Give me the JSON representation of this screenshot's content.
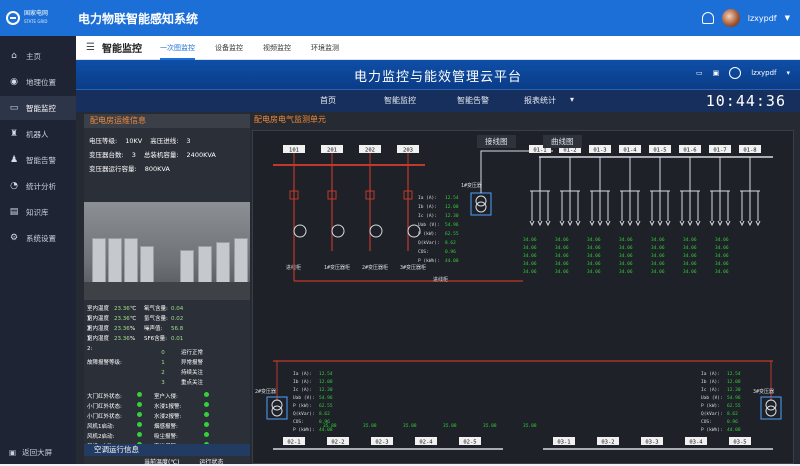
{
  "app": {
    "logo_line1": "国家电网",
    "logo_line2": "STATE GRID",
    "title": "电力物联智能感知系统",
    "user": "lzxypdf"
  },
  "sidebar": {
    "items": [
      {
        "label": "主页",
        "icon": "home-icon"
      },
      {
        "label": "地理位置",
        "icon": "map-pin-icon"
      },
      {
        "label": "智能监控",
        "icon": "monitor-icon"
      },
      {
        "label": "机器人",
        "icon": "robot-icon"
      },
      {
        "label": "智能告警",
        "icon": "alarm-icon"
      },
      {
        "label": "统计分析",
        "icon": "chart-icon"
      },
      {
        "label": "知识库",
        "icon": "book-icon"
      },
      {
        "label": "系统设置",
        "icon": "gear-icon"
      }
    ],
    "bottom": "返回大屏"
  },
  "subnav": {
    "page_title": "智能监控",
    "tabs": [
      "一次图监控",
      "设备监控",
      "视频监控",
      "环境监测"
    ]
  },
  "platform": {
    "title": "电力监控与能效管理云平台",
    "user": "lzxypdf",
    "nav": [
      "首页",
      "智能监控",
      "智能告警",
      "报表统计"
    ],
    "time": "10:44:36"
  },
  "ops": {
    "title": "配电房运维信息",
    "voltage_label": "电压等级:",
    "voltage": "10KV",
    "hv_label": "高压进线:",
    "hv": "3",
    "tx_label": "变压器台数:",
    "tx": "3",
    "cap_label": "总装机容量:",
    "cap": "2400KVA",
    "run_label": "变压器运行容量:",
    "run": "800KVA"
  },
  "monitor": {
    "title": "配电房电气监测单元",
    "tab1": "接线图",
    "tab2": "曲线图"
  },
  "env": {
    "rows": [
      [
        "室内温度1:",
        "23.36",
        "℃",
        "氧气含量:",
        "0.04"
      ],
      [
        "室内温度2:",
        "23.36",
        "℃",
        "氢气含量:",
        "0.02"
      ],
      [
        "室内湿度1:",
        "23.36",
        "%",
        "噪声值:",
        "56.8"
      ],
      [
        "室内湿度2:",
        "23.36",
        "%",
        "SF6含量:",
        "0.01"
      ]
    ],
    "alarm_label": "故障报警等级:",
    "alarm_levels": [
      [
        "0",
        "运行正常"
      ],
      [
        "1",
        "异常报警"
      ],
      [
        "2",
        "持续关注"
      ],
      [
        "3",
        "重点关注"
      ]
    ],
    "doors": [
      [
        "大门红外状态:",
        "室户入侵:"
      ],
      [
        "小门红外状态:",
        "水浸1报警:"
      ],
      [
        "小门红外状态:",
        "水浸2报警:"
      ],
      [
        "风机1启动:",
        "烟感报警:"
      ],
      [
        "风机2启动:",
        "吸尘报警:"
      ],
      [
        "风机3启动:",
        "声光报警:"
      ]
    ]
  },
  "ac": {
    "title": "空调运行信息",
    "col1": "当前温度(℃)",
    "col2": "运行状态"
  },
  "diagram": {
    "hv_bays": [
      "101",
      "201",
      "202",
      "203"
    ],
    "hv_labels": [
      "进线柜",
      "1#变压器柜",
      "2#变压器柜",
      "3#变压器柜"
    ],
    "t1": "1#变压器",
    "t2": "2#变压器",
    "t3": "3#变压器",
    "line_label": "进线柜",
    "meter_labels": [
      "Ia (A):",
      "Ib (A):",
      "Ic (A):",
      "Uab (V):",
      "P (kW):",
      "Q(kVar):",
      "COS:",
      "P (kWh):"
    ],
    "meter_vals": [
      "12.54",
      "12.08",
      "12.30",
      "54.96",
      "62.55",
      "8.62",
      "0.96",
      "44.08"
    ],
    "lv_top": [
      "01-1",
      "01-2",
      "01-3",
      "01-4",
      "01-5",
      "01-6",
      "01-7",
      "01-8"
    ],
    "lv_bot_left": [
      "02-1",
      "02-2",
      "02-3",
      "02-4",
      "02-5"
    ],
    "lv_bot_right": [
      "03-1",
      "03-2",
      "03-3",
      "03-4",
      "03-5"
    ],
    "mid_vals": [
      "34.06",
      "34.06",
      "34.06",
      "34.06",
      "34.06",
      "34.06",
      "34.06"
    ],
    "bot_vals": [
      "35.88",
      "35.88",
      "35.88",
      "35.88",
      "35.88",
      "35.88"
    ]
  }
}
